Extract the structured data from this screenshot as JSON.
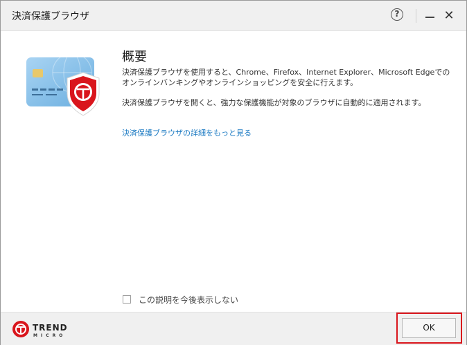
{
  "window": {
    "title": "決済保護ブラウザ",
    "help_label": "?"
  },
  "content": {
    "heading": "概要",
    "description_1": "決済保護ブラウザを使用すると、Chrome、Firefox、Internet Explorer、Microsoft Edgeでのオンラインバンキングやオンラインショッピングを安全に行えます。",
    "description_2": "決済保護ブラウザを開くと、強力な保護機能が対象のブラウザに自動的に適用されます。",
    "link_text": "決済保護ブラウザの詳細をもっと見る"
  },
  "options": {
    "dont_show_label": "この説明を今後表示しない",
    "dont_show_checked": false
  },
  "footer": {
    "logo_line1": "TREND",
    "logo_line2": "MICRO",
    "ok_label": "OK"
  },
  "colors": {
    "brand_red": "#d9151c",
    "link_blue": "#1a79c2",
    "card_blue": "#8ec3ea"
  }
}
